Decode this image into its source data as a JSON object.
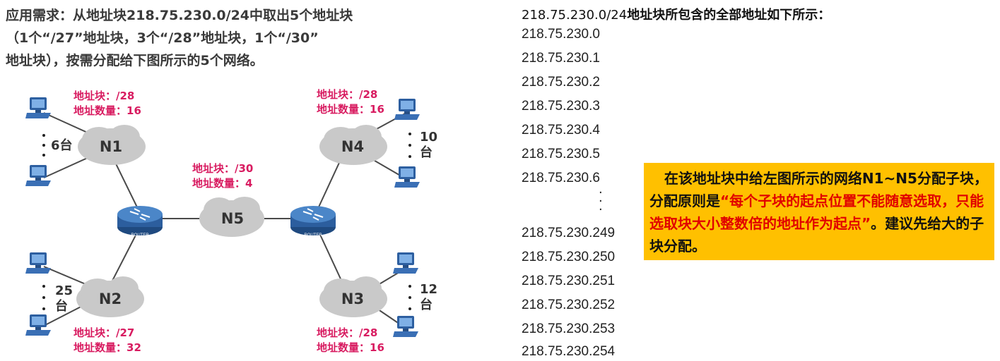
{
  "requirement": {
    "line1": "应用需求：从地址块218.75.230.0/24中取出5个地址块",
    "line2": "（1个“/27”地址块，3个“/28”地址块，1个“/30”",
    "line3": "地址块），按需分配给下图所示的5个网络。"
  },
  "networks": {
    "n1": {
      "label": "N1",
      "block": "地址块：/28",
      "count": "地址数量：16",
      "hosts": "6台"
    },
    "n2": {
      "label": "N2",
      "block": "地址块：/27",
      "count": "地址数量：32",
      "hosts_top": "25",
      "hosts_bottom": "台"
    },
    "n3": {
      "label": "N3",
      "block": "地址块：/28",
      "count": "地址数量：16",
      "hosts_top": "12",
      "hosts_bottom": "台"
    },
    "n4": {
      "label": "N4",
      "block": "地址块：/28",
      "count": "地址数量：16",
      "hosts_top": "10",
      "hosts_bottom": "台"
    },
    "n5": {
      "label": "N5",
      "block": "地址块：/30",
      "count": "地址数量：4"
    }
  },
  "router_label": "ROUTER",
  "address_list": {
    "title_prefix": "218.75.230.0/24",
    "title_suffix": "地址块所包含的全部地址如下所示：",
    "top": [
      "218.75.230.0",
      "218.75.230.1",
      "218.75.230.2",
      "218.75.230.3",
      "218.75.230.4",
      "218.75.230.5",
      "218.75.230.6"
    ],
    "bottom": [
      "218.75.230.249",
      "218.75.230.250",
      "218.75.230.251",
      "218.75.230.252",
      "218.75.230.253",
      "218.75.230.254"
    ]
  },
  "note": {
    "part1": "在该地址块中给左图所示的网络N1~N5分配子块，分配原则是",
    "part2": "“每个子块的起点位置不能随意选取，只能选取块大小整数倍的地址作为起点”",
    "part3": "。建议先给大的子块分配。"
  },
  "colors": {
    "annotation": "#d81b60",
    "note_bg": "#ffc000",
    "note_highlight": "#e10000",
    "cloud": "#c9c9c9",
    "router": "#2c5e9e"
  }
}
